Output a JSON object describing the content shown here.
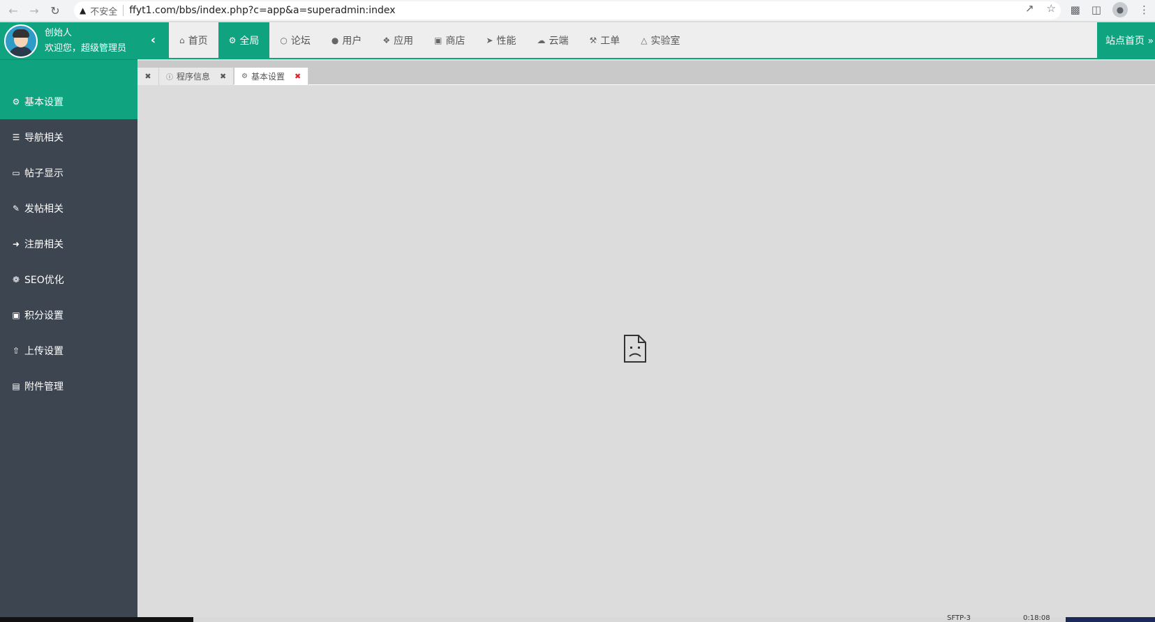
{
  "browser": {
    "back_icon": "arrow-left-icon",
    "forward_icon": "arrow-right-icon",
    "reload_icon": "reload-icon",
    "security_label": "不安全",
    "url": "ffyt1.com/bbs/index.php?c=app&a=superadmin:index"
  },
  "header": {
    "user_name": "创始人",
    "welcome": "欢迎您，超级管理员",
    "nav": [
      {
        "label": "首页",
        "icon": "home-icon"
      },
      {
        "label": "全局",
        "icon": "gears-icon",
        "active": true
      },
      {
        "label": "论坛",
        "icon": "comments-icon"
      },
      {
        "label": "用户",
        "icon": "users-icon"
      },
      {
        "label": "应用",
        "icon": "cubes-icon"
      },
      {
        "label": "商店",
        "icon": "shopping-bag-icon"
      },
      {
        "label": "性能",
        "icon": "paper-plane-icon"
      },
      {
        "label": "云端",
        "icon": "cloud-icon"
      },
      {
        "label": "工单",
        "icon": "wrench-icon"
      },
      {
        "label": "实验室",
        "icon": "flask-icon"
      }
    ],
    "site_home": "站点首页 »"
  },
  "sidebar": {
    "items": [
      {
        "label": "基本设置",
        "icon": "gear-icon",
        "active": true
      },
      {
        "label": "导航相关",
        "icon": "bars-icon"
      },
      {
        "label": "帖子显示",
        "icon": "desktop-icon"
      },
      {
        "label": "发帖相关",
        "icon": "edit-icon"
      },
      {
        "label": "注册相关",
        "icon": "sign-in-icon"
      },
      {
        "label": "SEO优化",
        "icon": "paw-icon"
      },
      {
        "label": "积分设置",
        "icon": "money-icon"
      },
      {
        "label": "上传设置",
        "icon": "upload-icon"
      },
      {
        "label": "附件管理",
        "icon": "folder-open-icon"
      }
    ]
  },
  "tabs": [
    {
      "label": "程序信息",
      "icon": "info-icon"
    },
    {
      "label": "基本设置",
      "icon": "gear-icon",
      "active": true
    }
  ],
  "content": {
    "state_icon": "broken-document-icon"
  },
  "taskbar": {
    "label_1": "SFTP-3",
    "label_2": "0:18:08"
  },
  "colors": {
    "accent": "#10a37f",
    "sidebar_bg": "#3c4550",
    "content_bg": "#dcdcdc"
  }
}
